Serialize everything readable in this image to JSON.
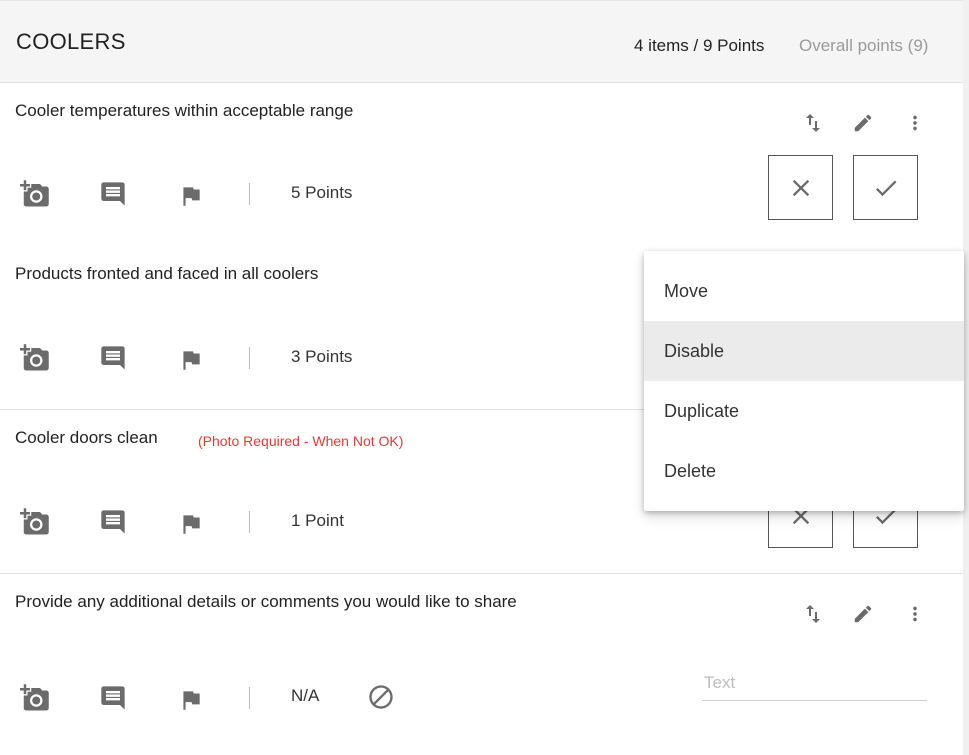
{
  "header": {
    "title": "COOLERS",
    "summary": "4 items / 9 Points",
    "overall": "Overall points (9)"
  },
  "items": [
    {
      "question": "Cooler temperatures within acceptable range",
      "points": "5 Points",
      "requirement": ""
    },
    {
      "question": "Products fronted and faced in all coolers",
      "points": "3 Points",
      "requirement": ""
    },
    {
      "question": "Cooler doors clean",
      "points": "1 Point",
      "requirement": "(Photo Required - When Not OK)"
    },
    {
      "question": "Provide any additional details or comments you would like to share",
      "points": "N/A",
      "requirement": "",
      "text_placeholder": "Text"
    }
  ],
  "context_menu": {
    "items": [
      "Move",
      "Disable",
      "Duplicate",
      "Delete"
    ],
    "highlighted": "Disable"
  },
  "icons": {
    "add_photo": "add-photo-icon",
    "comment": "comment-icon",
    "flag": "flag-icon",
    "reorder": "swap-vertical-icon",
    "edit": "pencil-icon",
    "more": "more-vertical-icon",
    "fail": "close-icon",
    "pass": "check-icon",
    "na": "block-icon"
  },
  "colors": {
    "icon": "#6b6b6b",
    "requirement_text": "#e53935",
    "header_bg": "#f5f5f5",
    "menu_highlight": "#ebebeb"
  }
}
